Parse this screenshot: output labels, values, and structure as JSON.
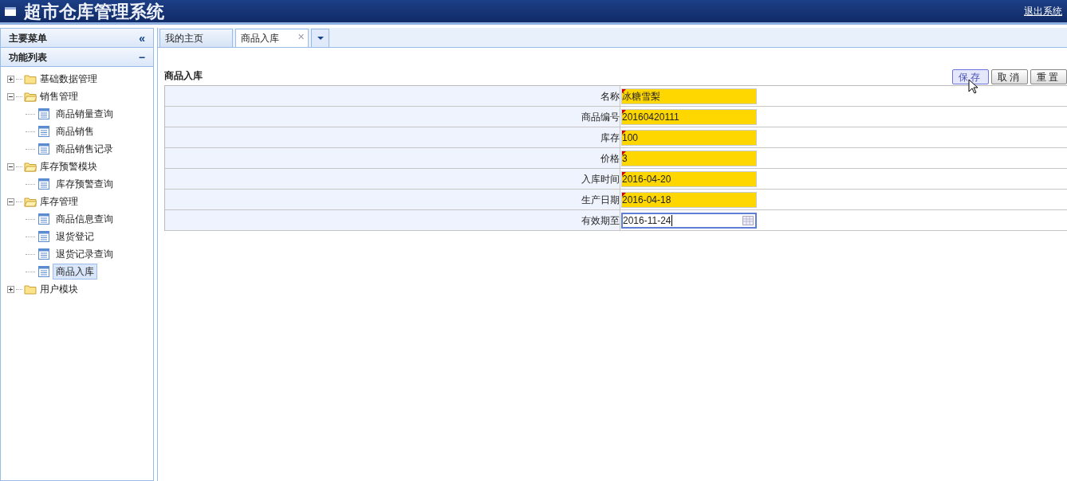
{
  "header": {
    "title": "超市仓库管理系统",
    "logout": "退出系统"
  },
  "sidebar": {
    "title": "主要菜单",
    "collapse": "«",
    "panel": {
      "title": "功能列表",
      "toggle": "−",
      "tree": [
        {
          "label": "基础数据管理",
          "expanded": false,
          "selected": false
        },
        {
          "label": "销售管理",
          "expanded": true,
          "selected": false,
          "children": [
            {
              "label": "商品销量查询",
              "selected": false
            },
            {
              "label": "商品销售",
              "selected": false
            },
            {
              "label": "商品销售记录",
              "selected": false
            }
          ]
        },
        {
          "label": "库存预警模块",
          "expanded": true,
          "selected": false,
          "children": [
            {
              "label": "库存预警查询",
              "selected": false
            }
          ]
        },
        {
          "label": "库存管理",
          "expanded": true,
          "selected": false,
          "children": [
            {
              "label": "商品信息查询",
              "selected": false
            },
            {
              "label": "退货登记",
              "selected": false
            },
            {
              "label": "退货记录查询",
              "selected": false
            },
            {
              "label": "商品入库",
              "selected": true
            }
          ]
        },
        {
          "label": "用户模块",
          "expanded": false,
          "selected": false
        }
      ]
    }
  },
  "tabs": [
    {
      "label": "我的主页",
      "selected": false
    },
    {
      "label": "商品入库",
      "selected": true,
      "close": "✕"
    }
  ],
  "form": {
    "title": "商品入库",
    "buttons": [
      {
        "label": "保存",
        "hovered": true
      },
      {
        "label": "取消",
        "hovered": false
      },
      {
        "label": "重置",
        "hovered": false
      }
    ],
    "fields": [
      {
        "label": "名称",
        "value": "冰糖雪梨",
        "kind": "text",
        "invalid": true,
        "focused": false
      },
      {
        "label": "商品编号",
        "value": "20160420111",
        "kind": "text",
        "invalid": true,
        "focused": false
      },
      {
        "label": "库存",
        "value": "100",
        "kind": "text",
        "invalid": true,
        "focused": false
      },
      {
        "label": "价格",
        "value": "3",
        "kind": "text",
        "invalid": true,
        "focused": false
      },
      {
        "label": "入库时间",
        "value": "2016-04-20",
        "kind": "text",
        "invalid": true,
        "focused": false
      },
      {
        "label": "生产日期",
        "value": "2016-04-18",
        "kind": "text",
        "invalid": true,
        "focused": false
      },
      {
        "label": "有效期至",
        "value": "2016-11-24",
        "kind": "date",
        "invalid": false,
        "focused": true
      }
    ]
  }
}
